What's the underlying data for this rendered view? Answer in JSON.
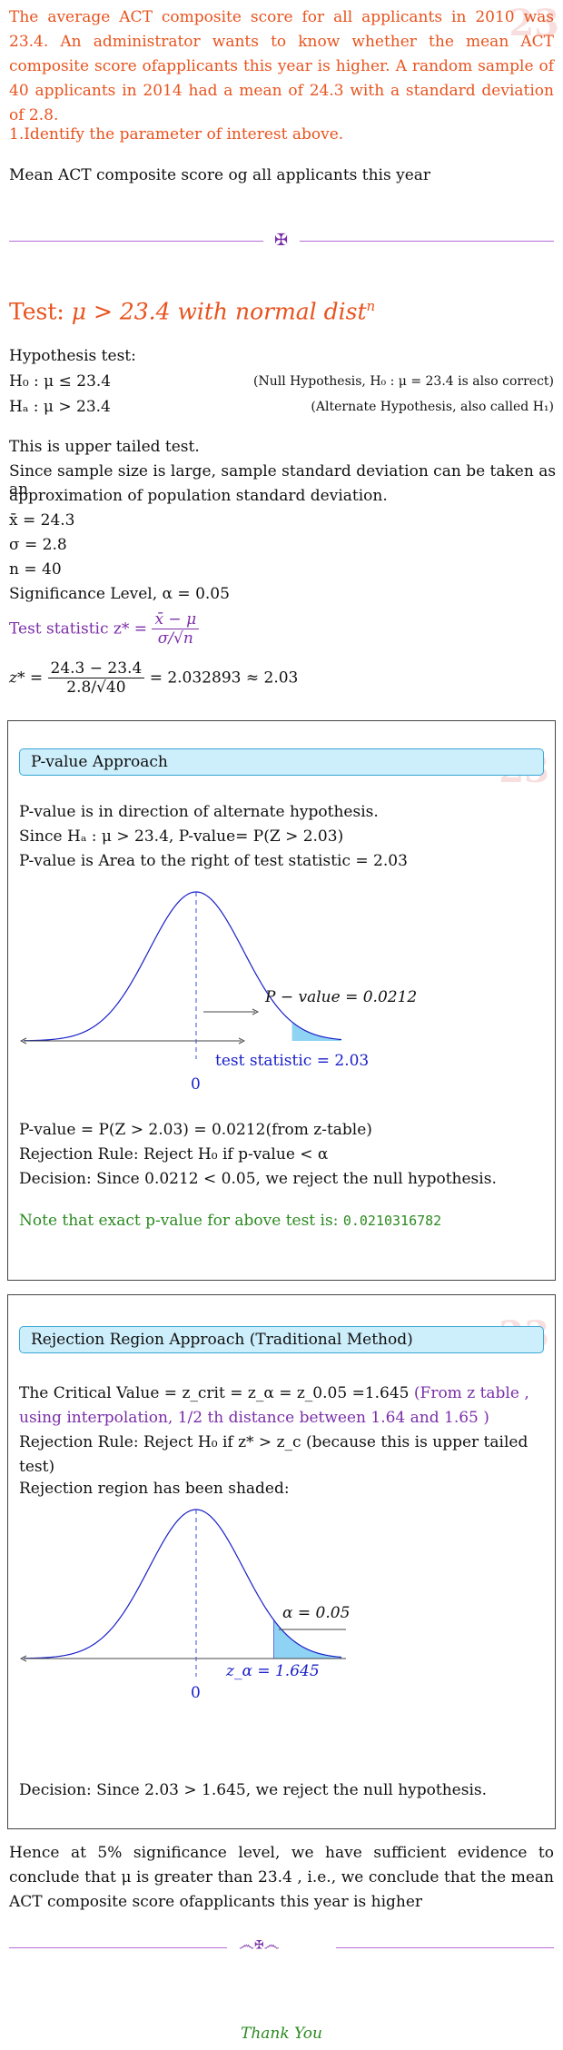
{
  "intro": {
    "paragraph": "The average ACT composite score for all applicants in 2010 was 23.4. An administrator wants to know whether the mean ACT composite score ofapplicants this year is higher. A random sample of 40 applicants in 2014 had a mean of 24.3 with a standard deviation of 2.8.",
    "question": "1.Identify the parameter of interest above.",
    "answer": "Mean ACT composite score og all applicants this year"
  },
  "divider1_glyph": "✠",
  "test_heading": {
    "prefix": "Test: ",
    "expr": "μ > 23.4 with normal dist",
    "sup": "n"
  },
  "hypothesis": {
    "title": "Hypothesis test:",
    "h0": "H₀ : μ ≤ 23.4",
    "h0_note": "(Null Hypothesis, H₀ : μ = 23.4 is also correct)",
    "ha": "Hₐ : μ > 23.4",
    "ha_note": "(Alternate Hypothesis, also called H₁)"
  },
  "body_lines": [
    "This is upper tailed test.",
    "Since sample size is large, sample standard deviation can be taken as an",
    "approximation of population standard deviation."
  ],
  "params": [
    "x̄ = 24.3",
    "σ = 2.8",
    "n = 40",
    "Significance Level, α = 0.05"
  ],
  "test_stat_label": "Test statistic z* =",
  "test_stat_formula": {
    "num": "x̄ − μ",
    "den": "σ/√n"
  },
  "z_calc": {
    "lhs": "z* =",
    "num": "24.3 − 23.4",
    "den": "2.8/√40",
    "rhs": "= 2.032893 ≈ 2.03"
  },
  "pvalue_box": {
    "title": "P-value Approach",
    "lines": [
      "P-value is in direction of alternate hypothesis.",
      "Since Hₐ : μ > 23.4, P-value= P(Z > 2.03)",
      "P-value is Area to the right of test statistic = 2.03"
    ],
    "graph_pvalue_label": "P − value = 0.0212",
    "graph_stat_label": "test statistic = 2.03",
    "graph_zero": "0",
    "result_lines": [
      "P-value = P(Z > 2.03) = 0.0212(from z-table)",
      "Rejection Rule: Reject H₀ if p-value < α",
      "Decision: Since 0.0212 < 0.05, we reject the null hypothesis."
    ],
    "note_text": "Note that exact p-value for above test is: ",
    "note_value": "0.0210316782"
  },
  "rejection_box": {
    "title": "Rejection Region Approach (Traditional Method)",
    "critical_prefix": "The Critical Value = z",
    "critical_line": "The Critical Value = z_crit = z_α = z_0.05 =1.645",
    "critical_note": "(From z table , using interpolation, 1/2 th distance between 1.64 and 1.65 )",
    "rule": "Rejection Rule: Reject H₀ if z* > z_c (because this is upper tailed test)",
    "shaded": "Rejection region has been shaded:",
    "graph_alpha_label": "α = 0.05",
    "graph_z_label": "z_α = 1.645",
    "graph_zero": "0",
    "decision": "Decision: Since 2.03 > 1.645, we reject the null hypothesis."
  },
  "conclusion": "Hence at 5% significance level, we have sufficient evidence to conclude that μ is greater than 23.4 , i.e., we conclude that the mean ACT composite score ofapplicants this year is higher",
  "divider2_glyph": "෴✠෴",
  "thank_you": "Thank You",
  "colors": {
    "accent_orange": "#e8531e",
    "purple": "#7a2ea8",
    "green": "#2b8a20",
    "curve_blue": "#1a20c8",
    "shade": "#8fd3f4"
  }
}
